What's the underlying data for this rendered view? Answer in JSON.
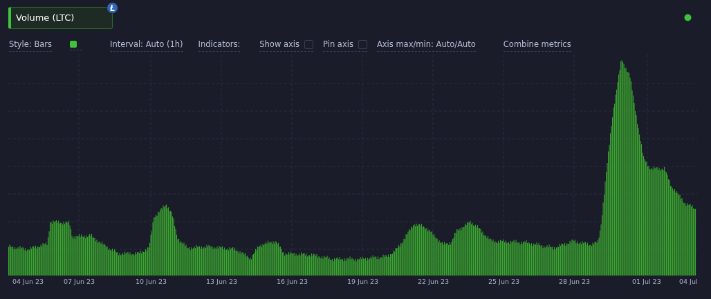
{
  "metric": {
    "label": "Volume (LTC)"
  },
  "options": [
    {
      "kind": "text",
      "label": "Style: Bars"
    },
    {
      "kind": "swatch",
      "color": "#3ec43a"
    },
    {
      "kind": "text",
      "label": "Interval: Auto (1h)"
    },
    {
      "kind": "text",
      "label": "Indicators:"
    },
    {
      "kind": "checkbox",
      "label": "Show axis",
      "checked": false
    },
    {
      "kind": "checkbox",
      "label": "Pin axis",
      "checked": false
    },
    {
      "kind": "text",
      "label": "Axis max/min: Auto/Auto"
    },
    {
      "kind": "text",
      "label": "Combine metrics"
    }
  ],
  "chart": {
    "x_labels": [
      "04 Jun 23",
      "07 Jun 23",
      "10 Jun 23",
      "13 Jun 23",
      "16 Jun 23",
      "19 Jun 23",
      "22 Jun 23",
      "25 Jun 23",
      "28 Jun 23",
      "01 Jul 23",
      "04 Jul"
    ]
  }
}
